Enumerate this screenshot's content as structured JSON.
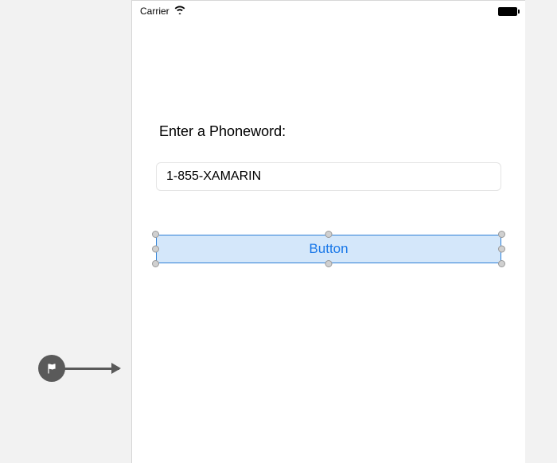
{
  "status": {
    "carrier": "Carrier"
  },
  "form": {
    "label": "Enter a Phoneword:",
    "phoneword_value": "1-855-XAMARIN",
    "button_label": "Button"
  }
}
